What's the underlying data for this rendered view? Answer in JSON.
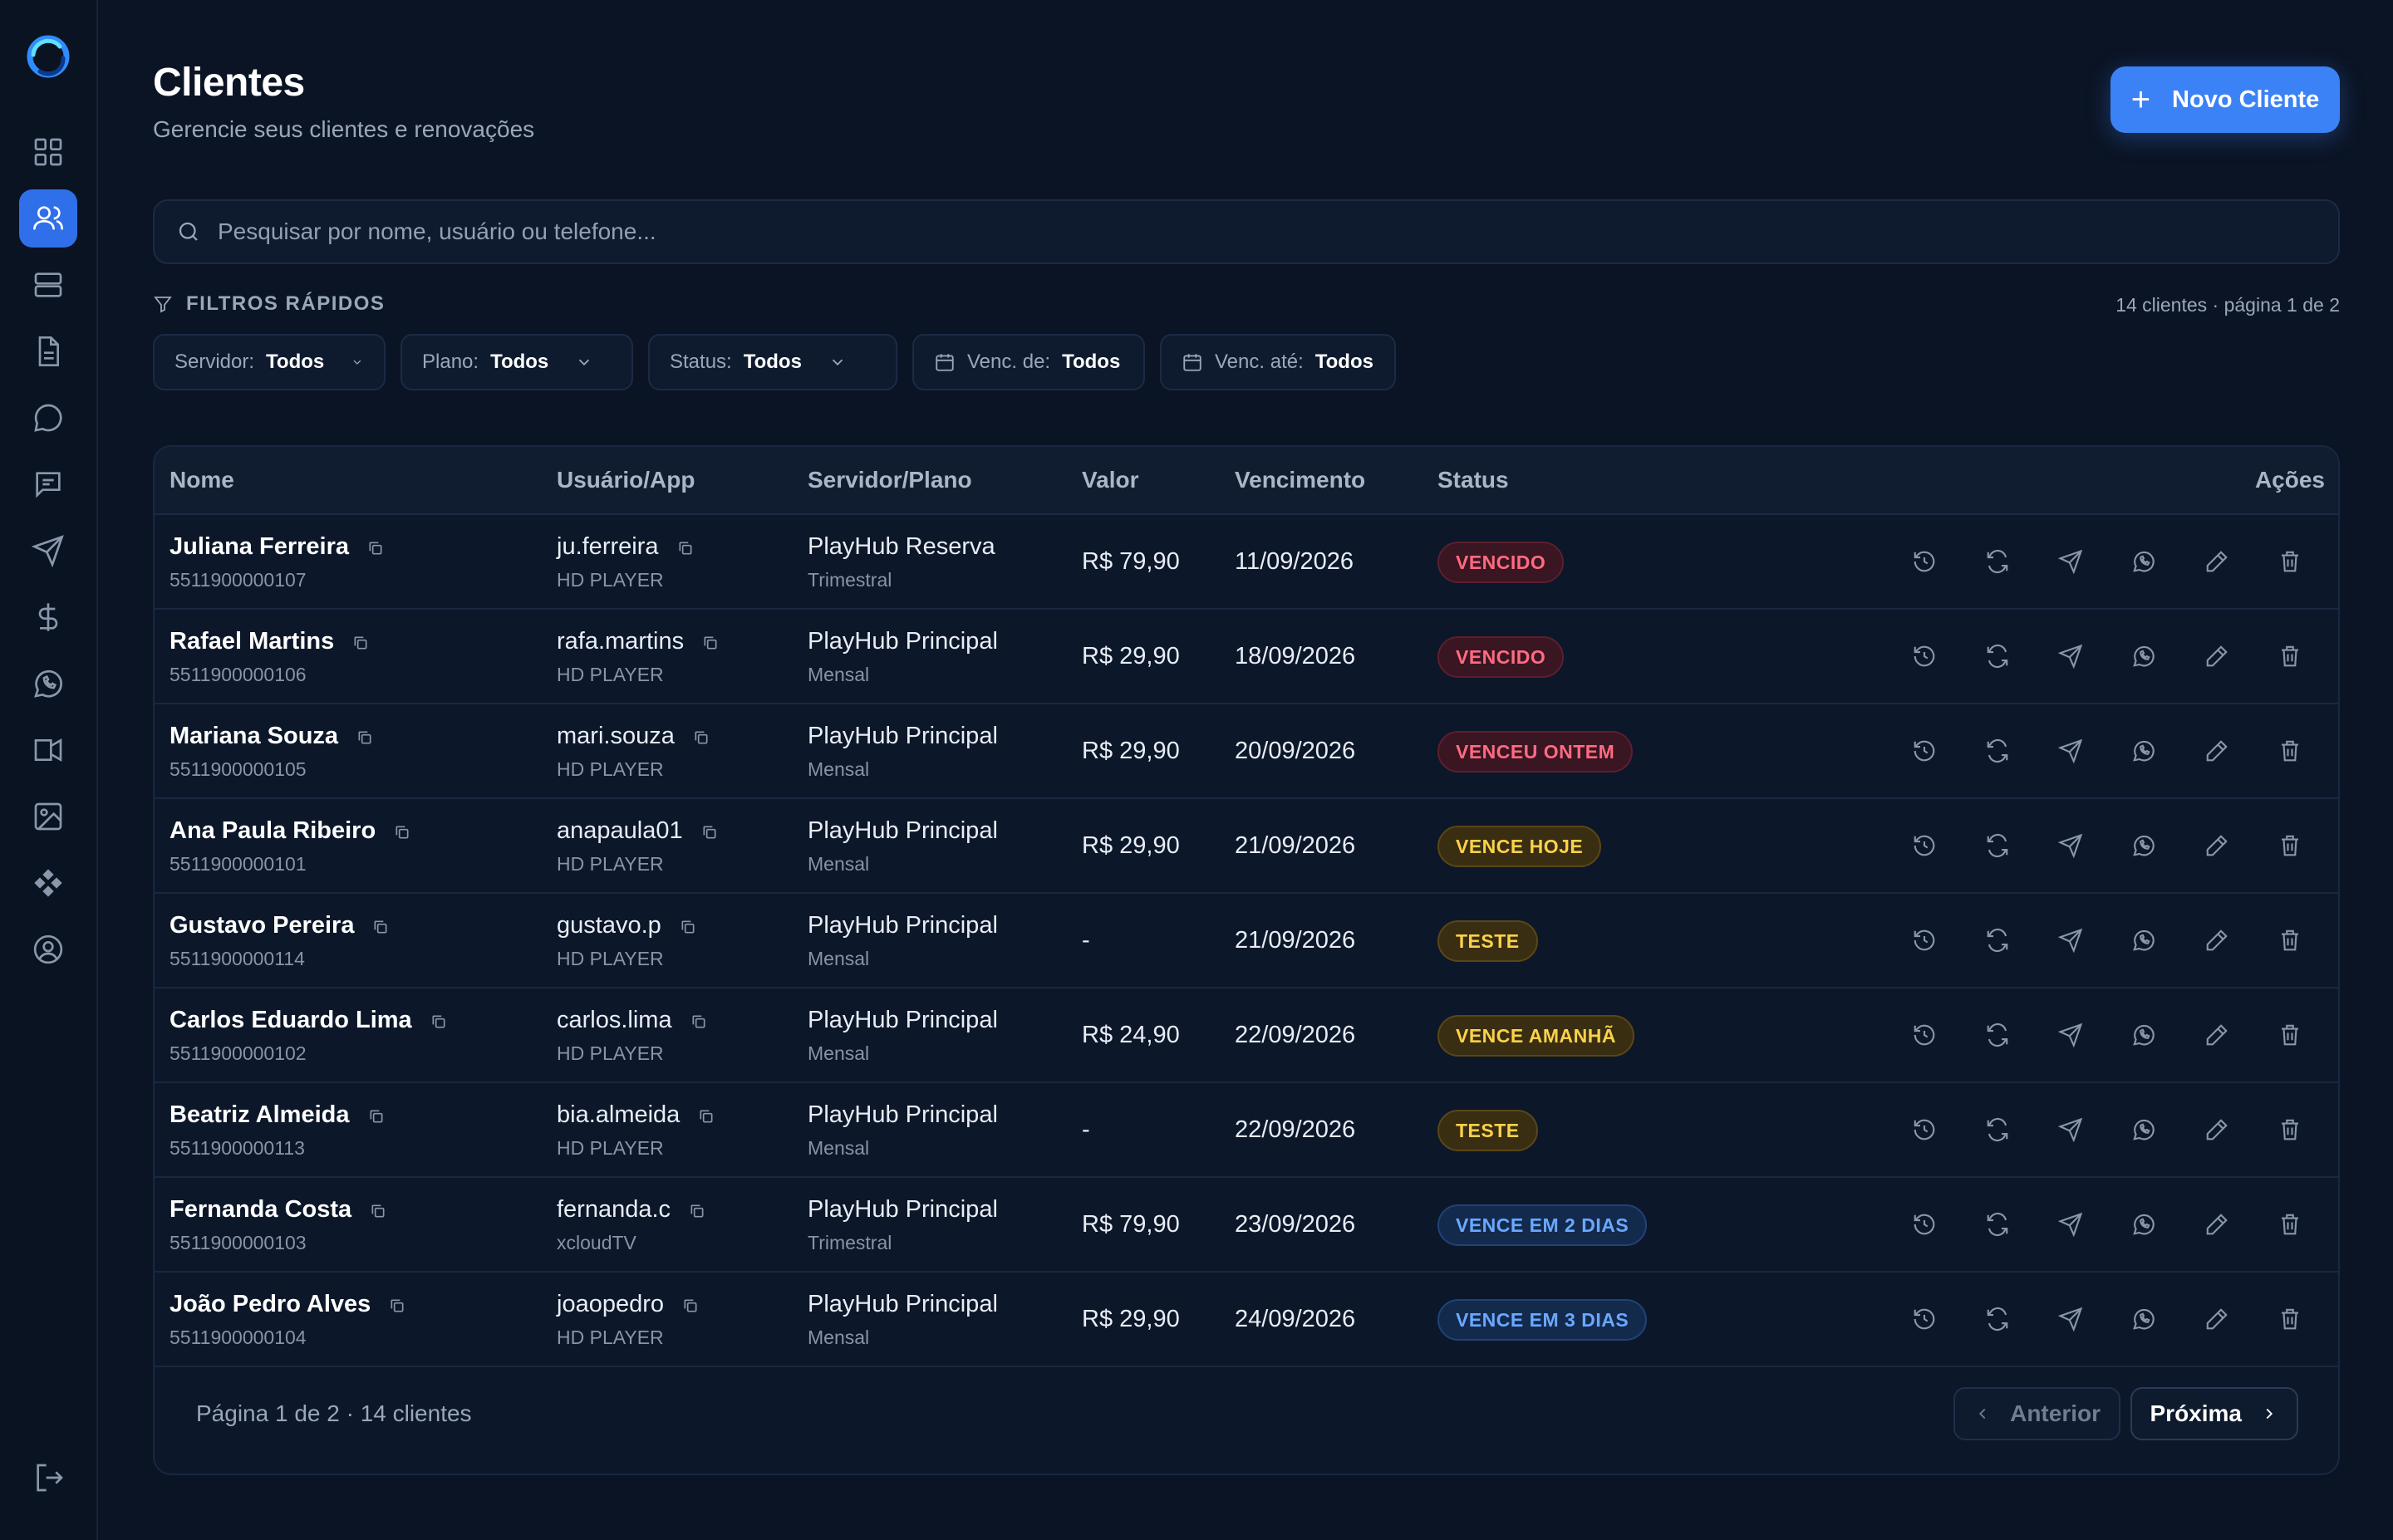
{
  "header": {
    "title": "Clientes",
    "subtitle": "Gerencie seus clientes e renovações",
    "new_button": "Novo Cliente"
  },
  "search": {
    "placeholder": "Pesquisar por nome, usuário ou telefone..."
  },
  "filters": {
    "label": "FILTROS RÁPIDOS",
    "counter": "14 clientes · página 1 de 2",
    "items": [
      {
        "label": "Servidor:",
        "value": "Todos"
      },
      {
        "label": "Plano:",
        "value": "Todos"
      },
      {
        "label": "Status:",
        "value": "Todos"
      },
      {
        "label": "Venc. de:",
        "value": "Todos"
      },
      {
        "label": "Venc. até:",
        "value": "Todos"
      }
    ]
  },
  "table": {
    "columns": [
      "Nome",
      "Usuário/App",
      "Servidor/Plano",
      "Valor",
      "Vencimento",
      "Status",
      "Ações"
    ],
    "rows": [
      {
        "name": "Juliana Ferreira",
        "phone": "5511900000107",
        "user": "ju.ferreira",
        "app": "HD PLAYER",
        "server": "PlayHub Reserva",
        "plan": "Trimestral",
        "value": "R$ 79,90",
        "due": "11/09/2026",
        "status": "VENCIDO",
        "tone": "red"
      },
      {
        "name": "Rafael Martins",
        "phone": "5511900000106",
        "user": "rafa.martins",
        "app": "HD PLAYER",
        "server": "PlayHub Principal",
        "plan": "Mensal",
        "value": "R$ 29,90",
        "due": "18/09/2026",
        "status": "VENCIDO",
        "tone": "red"
      },
      {
        "name": "Mariana Souza",
        "phone": "5511900000105",
        "user": "mari.souza",
        "app": "HD PLAYER",
        "server": "PlayHub Principal",
        "plan": "Mensal",
        "value": "R$ 29,90",
        "due": "20/09/2026",
        "status": "VENCEU ONTEM",
        "tone": "red"
      },
      {
        "name": "Ana Paula Ribeiro",
        "phone": "5511900000101",
        "user": "anapaula01",
        "app": "HD PLAYER",
        "server": "PlayHub Principal",
        "plan": "Mensal",
        "value": "R$ 29,90",
        "due": "21/09/2026",
        "status": "VENCE HOJE",
        "tone": "yellow"
      },
      {
        "name": "Gustavo Pereira",
        "phone": "5511900000114",
        "user": "gustavo.p",
        "app": "HD PLAYER",
        "server": "PlayHub Principal",
        "plan": "Mensal",
        "value": "-",
        "due": "21/09/2026",
        "status": "TESTE",
        "tone": "yellow"
      },
      {
        "name": "Carlos Eduardo Lima",
        "phone": "5511900000102",
        "user": "carlos.lima",
        "app": "HD PLAYER",
        "server": "PlayHub Principal",
        "plan": "Mensal",
        "value": "R$ 24,90",
        "due": "22/09/2026",
        "status": "VENCE AMANHÃ",
        "tone": "yellow"
      },
      {
        "name": "Beatriz Almeida",
        "phone": "5511900000113",
        "user": "bia.almeida",
        "app": "HD PLAYER",
        "server": "PlayHub Principal",
        "plan": "Mensal",
        "value": "-",
        "due": "22/09/2026",
        "status": "TESTE",
        "tone": "yellow"
      },
      {
        "name": "Fernanda Costa",
        "phone": "5511900000103",
        "user": "fernanda.c",
        "app": "xcloudTV",
        "server": "PlayHub Principal",
        "plan": "Trimestral",
        "value": "R$ 79,90",
        "due": "23/09/2026",
        "status": "VENCE EM 2 DIAS",
        "tone": "blue"
      },
      {
        "name": "João Pedro Alves",
        "phone": "5511900000104",
        "user": "joaopedro",
        "app": "HD PLAYER",
        "server": "PlayHub Principal",
        "plan": "Mensal",
        "value": "R$ 29,90",
        "due": "24/09/2026",
        "status": "VENCE EM 3 DIAS",
        "tone": "blue"
      }
    ]
  },
  "pagination": {
    "summary": "Página 1 de 2 · 14 clientes",
    "prev": "Anterior",
    "next": "Próxima"
  },
  "colors": {
    "accent": "#3b82f6",
    "background": "#0b1424",
    "danger": "#ff6b81",
    "warning": "#fbd24a",
    "info": "#6aa8ff"
  },
  "icons": {
    "sidebar": [
      "dashboard-icon",
      "users-icon",
      "server-icon",
      "document-icon",
      "chat-bubble-icon",
      "message-icon",
      "send-icon",
      "dollar-icon",
      "whatsapp-icon",
      "campaign-icon",
      "image-icon",
      "puzzle-icon",
      "profile-icon"
    ],
    "row_actions": [
      "history-icon",
      "renew-icon",
      "send-icon",
      "whatsapp-icon",
      "edit-icon",
      "delete-icon"
    ]
  }
}
